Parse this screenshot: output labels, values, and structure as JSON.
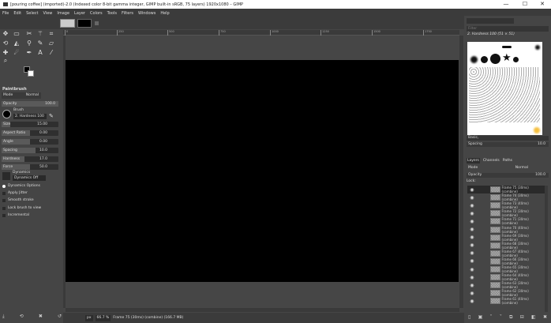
{
  "window": {
    "title": "[pouring coffee] (imported)-2.0 (Indexed color 8-bit gamma integer, GIMP built-in sRGB, 75 layers) 1920x1080 – GIMP",
    "minimize": "—",
    "maximize": "☐",
    "close": "✕"
  },
  "menu": [
    "File",
    "Edit",
    "Select",
    "View",
    "Image",
    "Layer",
    "Colors",
    "Tools",
    "Filters",
    "Windows",
    "Help"
  ],
  "tool_options": {
    "title": "Paintbrush",
    "mode_label": "Mode",
    "mode_value": "Normal",
    "opacity_label": "Opacity",
    "opacity_value": "100.0",
    "brush_label": "Brush",
    "brush_value": "2. Hardness 100",
    "sliders": [
      {
        "label": "Size",
        "value": "15.00",
        "fraction": 0.15
      },
      {
        "label": "Aspect Ratio",
        "value": "0.00",
        "fraction": 0.5
      },
      {
        "label": "Angle",
        "value": "0.00",
        "fraction": 0.5
      },
      {
        "label": "Spacing",
        "value": "10.0",
        "fraction": 0.6
      },
      {
        "label": "Hardness",
        "value": "17.0",
        "fraction": 0.4
      },
      {
        "label": "Force",
        "value": "50.0",
        "fraction": 0.5
      }
    ],
    "dynamics_label": "Dynamics",
    "dynamics_value": "Dynamics Off",
    "options": [
      "Dynamics Options",
      "Apply Jitter",
      "Smooth stroke",
      "Lock brush to view",
      "Incremental"
    ]
  },
  "ruler": [
    "0",
    "250",
    "500",
    "750",
    "1000",
    "1250",
    "1500",
    "1750"
  ],
  "status": {
    "unit": "px",
    "zoom": "66.7 %",
    "info": "Frame 75 (30ms) (combine) (166.7 MB)"
  },
  "brushes": {
    "filter_placeholder": "Filter",
    "selected": "2. Hardness 100 (51 × 51)",
    "preset": "Basic,",
    "spacing_label": "Spacing",
    "spacing_value": "10.0"
  },
  "layers": {
    "tabs": [
      "Layers",
      "Channels",
      "Paths"
    ],
    "mode_label": "Mode",
    "mode_value": "Normal",
    "opacity_label": "Opacity",
    "opacity_value": "100.0",
    "lock_label": "Lock:",
    "items": [
      "Frame 75 (30ms) (combine)",
      "Frame 74 (30ms) (combine)",
      "Frame 73 (40ms) (combine)",
      "Frame 72 (30ms) (combine)",
      "Frame 71 (30ms) (combine)",
      "Frame 70 (40ms) (combine)",
      "Frame 69 (30ms) (combine)",
      "Frame 68 (30ms) (combine)",
      "Frame 67 (40ms) (combine)",
      "Frame 66 (30ms) (combine)",
      "Frame 65 (30ms) (combine)",
      "Frame 64 (40ms) (combine)",
      "Frame 63 (30ms) (combine)",
      "Frame 62 (30ms) (combine)",
      "Frame 61 (40ms) (combine)"
    ]
  }
}
